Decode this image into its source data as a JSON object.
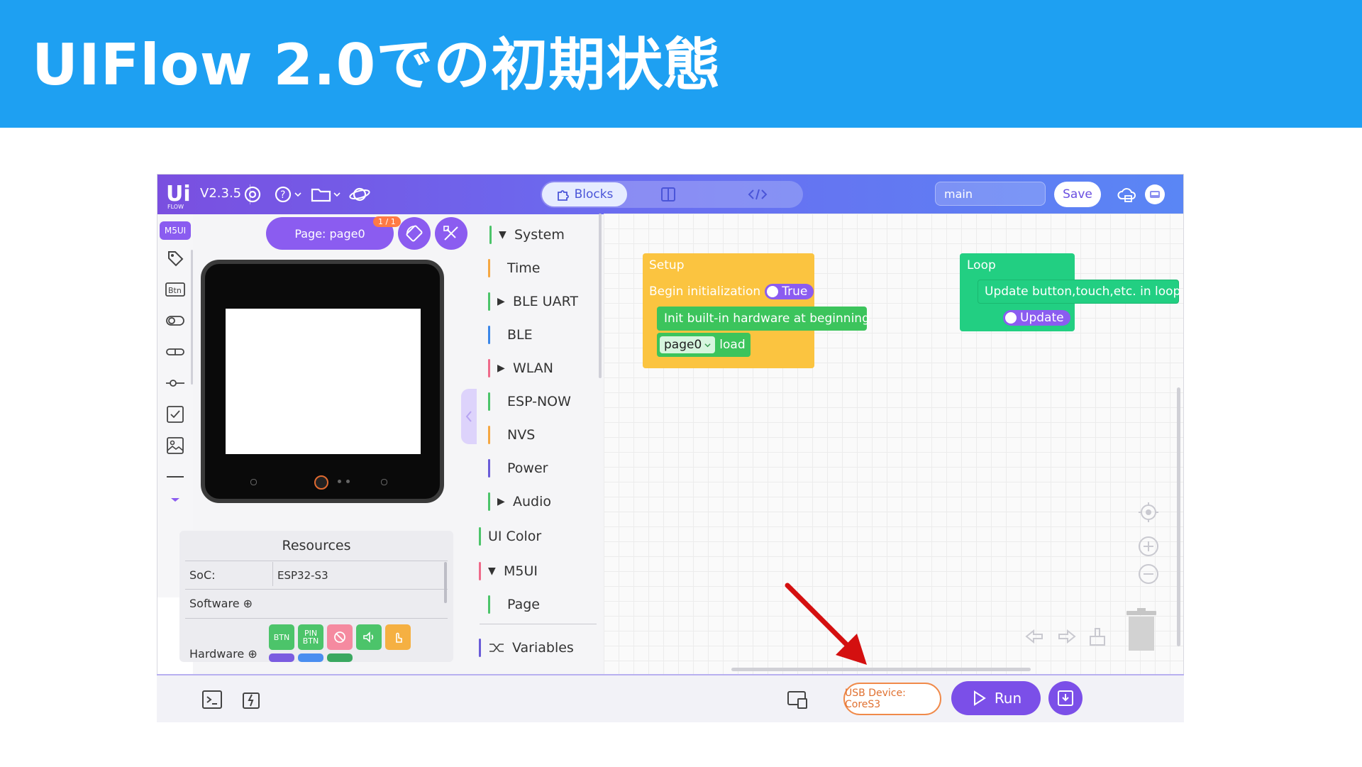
{
  "slide": {
    "title": "UIFlow 2.0での初期状態"
  },
  "topbar": {
    "logo": "Ui FLOW",
    "version": "V2.3.5",
    "icons": [
      "settings-icon",
      "help-icon",
      "folder-icon",
      "planet-icon"
    ],
    "tabs": {
      "blocks": "Blocks"
    },
    "filename": "main",
    "save_label": "Save",
    "right_icons": [
      "cloud-icon",
      "account-icon"
    ]
  },
  "toolstrip": {
    "badge": "M5UI",
    "btn_label": "Btn",
    "icons": [
      "tag-icon",
      "btn-icon",
      "switch-icon",
      "toggle-icon",
      "slider-icon",
      "checkbox-icon",
      "image-icon",
      "line-icon",
      "more-icon"
    ]
  },
  "device_panel": {
    "page_label": "Page: page0",
    "page_count": "1 / 1",
    "resources": {
      "title": "Resources",
      "soc_label": "SoC:",
      "soc_value": "ESP32-S3",
      "software_label": "Software ⊕",
      "hardware_label": "Hardware ⊕",
      "hardware_buttons": [
        {
          "label": "BTN",
          "color": "#4cc46a"
        },
        {
          "label": "PIN BTN",
          "color": "#4cc46a"
        },
        {
          "label": "",
          "color": "#f58aa0"
        },
        {
          "label": "",
          "color": "#4cc46a"
        },
        {
          "label": "",
          "color": "#f5b042"
        }
      ]
    }
  },
  "palette": {
    "categories": [
      {
        "label": "System",
        "arrow": "▼",
        "color": "#4cc46a"
      },
      {
        "label": "Time",
        "arrow": "",
        "color": "#f5a742"
      },
      {
        "label": "BLE UART",
        "arrow": "▶",
        "color": "#4cc46a"
      },
      {
        "label": "BLE",
        "arrow": "",
        "color": "#3a86e8"
      },
      {
        "label": "WLAN",
        "arrow": "▶",
        "color": "#ef6a8a"
      },
      {
        "label": "ESP-NOW",
        "arrow": "",
        "color": "#4cc46a"
      },
      {
        "label": "NVS",
        "arrow": "",
        "color": "#f5a742"
      },
      {
        "label": "Power",
        "arrow": "",
        "color": "#6a5cd8"
      },
      {
        "label": "Audio",
        "arrow": "▶",
        "color": "#4cc46a"
      },
      {
        "label": "UI Color",
        "arrow": "",
        "color": "#4cc46a"
      },
      {
        "label": "M5UI",
        "arrow": "▼",
        "color": "#ef6a8a"
      },
      {
        "label": "Page",
        "arrow": "",
        "color": "#4cc46a"
      },
      {
        "label": "Variables",
        "arrow": "",
        "color": "#6a5cd8"
      }
    ]
  },
  "workspace": {
    "setup": {
      "title": "Setup",
      "begin_label": "Begin initialization",
      "begin_value": "True",
      "init_label": "Init built-in hardware at beginning",
      "page_select": "page0",
      "page_action": "load",
      "color": "#fbc440"
    },
    "loop": {
      "title": "Loop",
      "update_label": "Update button,touch,etc. in loop",
      "update_value": "Update",
      "color": "#22cf82"
    }
  },
  "bottombar": {
    "usb_device": "USB Device: CoreS3",
    "run_label": "Run"
  },
  "annotation": {
    "arrow_color": "#d41010"
  }
}
